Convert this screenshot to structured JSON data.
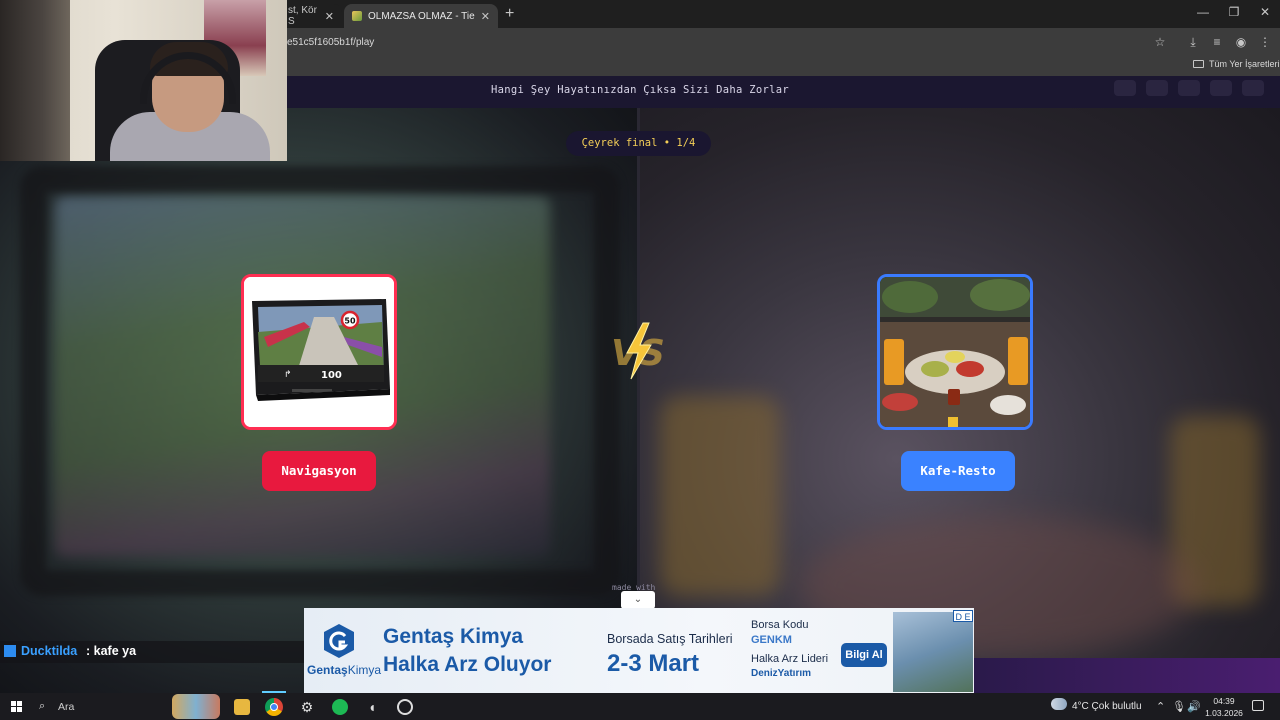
{
  "browser": {
    "tabs": [
      {
        "label": "st, Kör S",
        "active": false
      },
      {
        "label": "OLMAZSA OLMAZ - Tier List, K",
        "active": true
      }
    ],
    "new_tab_glyph": "+",
    "url": "e51c5f1605b1f/play",
    "bookmarks_label": "Tüm Yer İşaretleri",
    "window_controls": {
      "minimize": "—",
      "restore": "❐",
      "close": "✕"
    }
  },
  "game": {
    "title": "Hangi Şey Hayatınızdan Çıksa Sizi Daha Zorlar",
    "round_label": "Çeyrek final • 1/4",
    "left": {
      "name": "Navigasyon",
      "border_color": "#ff2e52"
    },
    "right": {
      "name": "Kafe-Resto",
      "border_color": "#3a7bff"
    },
    "vs_text": "VS",
    "made_with": "made with"
  },
  "ad": {
    "brand": "Gentaş",
    "brand_suffix": "Kimya",
    "headline_1": "Gentaş Kimya",
    "headline_2": "Halka Arz Oluyor",
    "subheadline": "Borsada Satış Tarihleri",
    "dates": "2-3 Mart",
    "code_label": "Borsa Kodu",
    "code": "GENKM",
    "lead_label": "Halka Arz Lideri",
    "bank": "DenizYatırım",
    "info_button": "Bilgi Al",
    "badge": "D E"
  },
  "chat": {
    "user": "Ducktilda",
    "message": ": kafe ya"
  },
  "taskbar": {
    "search_placeholder": "Ara",
    "weather": "4°C  Çok bulutlu",
    "time": "04:39",
    "date": "1.03.2026"
  }
}
